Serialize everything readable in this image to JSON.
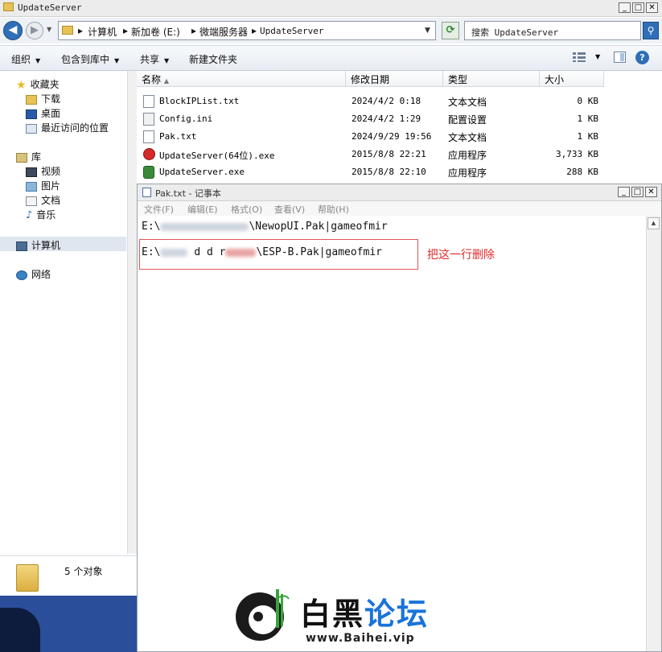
{
  "explorer": {
    "title": "UpdateServer",
    "breadcrumb": [
      "计算机",
      "新加卷 (E:)",
      "微端服务器",
      "UpdateServer"
    ],
    "search_placeholder": "搜索 UpdateServer",
    "toolbar": {
      "organize": "组织",
      "include_in_library": "包含到库中",
      "share": "共享",
      "new_folder": "新建文件夹"
    },
    "nav": {
      "favorites": "收藏夹",
      "downloads": "下载",
      "desktop": "桌面",
      "recent": "最近访问的位置",
      "libraries": "库",
      "videos": "视频",
      "pictures": "图片",
      "documents": "文档",
      "music": "音乐",
      "computer": "计算机",
      "network": "网络"
    },
    "columns": {
      "name": "名称",
      "date": "修改日期",
      "type": "类型",
      "size": "大小"
    },
    "files": [
      {
        "name": "BlockIPList.txt",
        "date": "2024/4/2 0:18",
        "type": "文本文档",
        "size": "0 KB",
        "icon": "text-file-icon"
      },
      {
        "name": "Config.ini",
        "date": "2024/4/2 1:29",
        "type": "配置设置",
        "size": "1 KB",
        "icon": "config-file-icon"
      },
      {
        "name": "Pak.txt",
        "date": "2024/9/29 19:56",
        "type": "文本文档",
        "size": "1 KB",
        "icon": "text-file-icon"
      },
      {
        "name": "UpdateServer(64位).exe",
        "date": "2015/8/8 22:21",
        "type": "应用程序",
        "size": "3,733 KB",
        "icon": "red-app-icon"
      },
      {
        "name": "UpdateServer.exe",
        "date": "2015/8/8 22:10",
        "type": "应用程序",
        "size": "288 KB",
        "icon": "green-app-icon"
      }
    ],
    "details_count": "5 个对象"
  },
  "notepad": {
    "title": "Pak.txt - 记事本",
    "menu": [
      "文件(F)",
      "编辑(E)",
      "格式(O)",
      "查看(V)",
      "帮助(H)"
    ],
    "line1_prefix": "E:\\",
    "line1_suffix": "\\NewopUI.Pak|gameofmir",
    "line2_prefix": "E:\\",
    "line2_mid": "d d r",
    "line2_suffix": "\\ESP-B.Pak|gameofmir",
    "annotation": "把这一行删除"
  },
  "watermark": {
    "brand_part1": "白黑",
    "brand_part2": "论坛",
    "url": "www.Baihei.vip"
  },
  "colors": {
    "accent_blue": "#2f6fb8",
    "annotation_red": "#e02b2b",
    "brand_blue": "#1a73d9"
  }
}
